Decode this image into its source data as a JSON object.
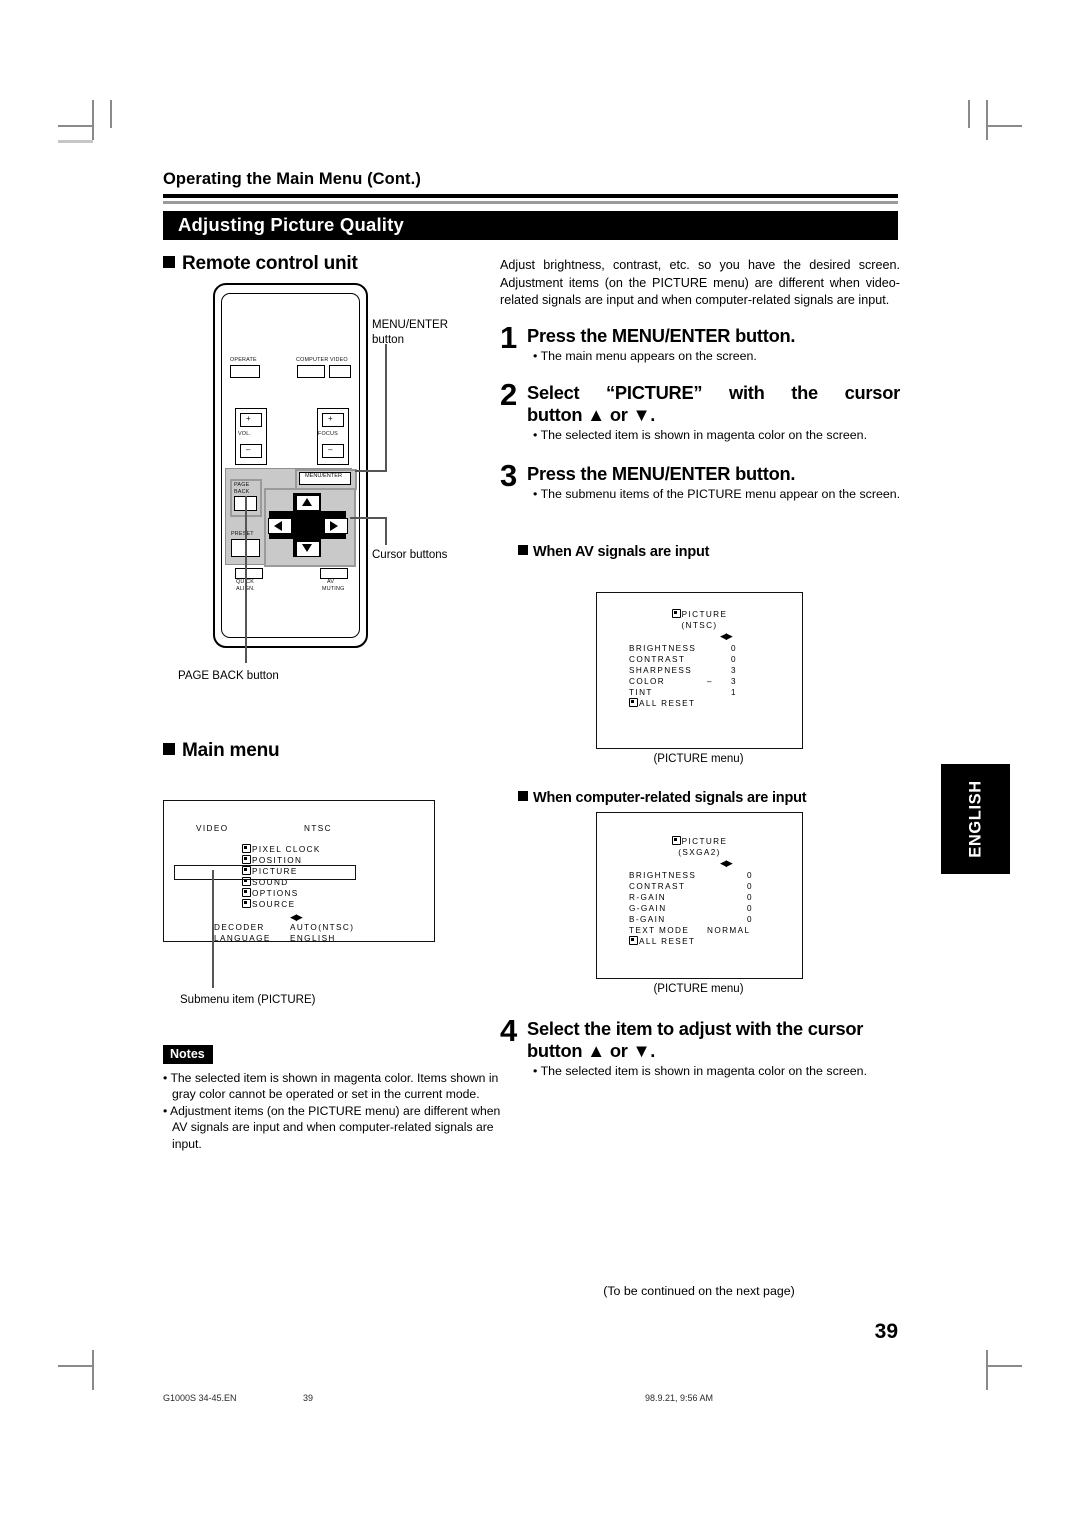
{
  "header": {
    "running_head": "Operating the Main Menu (Cont.)",
    "section_title": "Adjusting Picture Quality"
  },
  "left_column": {
    "remote_heading": "Remote control unit",
    "main_menu_heading": "Main menu",
    "remote": {
      "buttons": [
        {
          "name": "operate",
          "label": "OPERATE"
        },
        {
          "name": "computer",
          "label": "COMPUTER"
        },
        {
          "name": "video",
          "label": "VIDEO"
        },
        {
          "name": "volume",
          "label": "VOL."
        },
        {
          "name": "focus",
          "label": "FOCUS"
        },
        {
          "name": "plus",
          "label": "+"
        },
        {
          "name": "minus",
          "label": "–"
        },
        {
          "name": "menu-enter",
          "label": "MENU/ENTER"
        },
        {
          "name": "page-back",
          "label": "PAGE\nBACK"
        },
        {
          "name": "page-back-line1",
          "label": "PAGE"
        },
        {
          "name": "page-back-line2",
          "label": "BACK"
        },
        {
          "name": "preset",
          "label": "PRESET"
        },
        {
          "name": "quick-align-line1",
          "label": "QUICK"
        },
        {
          "name": "quick-align-line2",
          "label": "ALIGN."
        },
        {
          "name": "av-muting-line1",
          "label": "AV"
        },
        {
          "name": "av-muting-line2",
          "label": "MUTING"
        }
      ],
      "callouts": {
        "menu_enter": "MENU/ENTER\nbutton",
        "menu_enter_line1": "MENU/ENTER",
        "menu_enter_line2": "button",
        "cursor": "Cursor buttons",
        "page_back": "PAGE BACK button"
      }
    },
    "main_menu_osd": {
      "source": "VIDEO",
      "signal": "NTSC",
      "submenu_items": [
        "PIXEL CLOCK",
        "POSITION",
        "PICTURE",
        "SOUND",
        "OPTIONS",
        "SOURCE"
      ],
      "highlighted_item": "PICTURE",
      "arrows": "◀▶",
      "settings": [
        {
          "label": "DECODER",
          "value": "AUTO(NTSC)"
        },
        {
          "label": "LANGUAGE",
          "value": "ENGLISH"
        }
      ],
      "caption": "Submenu item (PICTURE)"
    },
    "notes": {
      "tag": "Notes",
      "items": [
        "The selected item is shown in magenta color. Items shown in gray color cannot be operated or set in the current mode.",
        "Adjustment items (on the PICTURE menu) are different when AV signals are input and when computer-related signals are input."
      ]
    }
  },
  "right_column": {
    "intro": "Adjust brightness, contrast, etc. so you have the desired screen. Adjustment items (on the PICTURE menu) are different when video-related signals are input and when computer-related signals are input.",
    "steps": [
      {
        "number": "1",
        "heading": "Press the MENU/ENTER button.",
        "bullet": "The main menu appears on the screen."
      },
      {
        "number": "2",
        "heading_line1": "Select “PICTURE” with the cursor",
        "heading_line2": "button ▲ or ▼.",
        "bullet": "The selected item is shown in magenta color on the screen."
      },
      {
        "number": "3",
        "heading": "Press the MENU/ENTER button.",
        "bullet": "The submenu items of the PICTURE menu appear on the screen."
      },
      {
        "number": "4",
        "heading_line1": "Select the item to adjust with the cursor",
        "heading_line2": "button ▲ or ▼.",
        "bullet": "The selected item is shown in magenta color on the screen."
      }
    ],
    "av_section": {
      "heading": "When AV signals are input",
      "osd": {
        "title": "PICTURE",
        "signal": "(NTSC)",
        "arrows": "◀▶",
        "rows": [
          {
            "label": "BRIGHTNESS",
            "sign": "",
            "value": "0"
          },
          {
            "label": "CONTRAST",
            "sign": "",
            "value": "0"
          },
          {
            "label": "SHARPNESS",
            "sign": "",
            "value": "3"
          },
          {
            "label": "COLOR",
            "sign": "–",
            "value": "3"
          },
          {
            "label": "TINT",
            "sign": "",
            "value": "1"
          }
        ],
        "reset": "ALL RESET"
      },
      "caption": "(PICTURE menu)"
    },
    "pc_section": {
      "heading": "When computer-related signals are input",
      "osd": {
        "title": "PICTURE",
        "signal": "(SXGA2)",
        "arrows": "◀▶",
        "rows": [
          {
            "label": "BRIGHTNESS",
            "sign": "",
            "value": "0"
          },
          {
            "label": "CONTRAST",
            "sign": "",
            "value": "0"
          },
          {
            "label": "R-GAIN",
            "sign": "",
            "value": "0"
          },
          {
            "label": "G-GAIN",
            "sign": "",
            "value": "0"
          },
          {
            "label": "B-GAIN",
            "sign": "",
            "value": "0"
          },
          {
            "label": "TEXT MODE",
            "sign": "",
            "value": "NORMAL"
          }
        ],
        "reset": "ALL RESET"
      },
      "caption": "(PICTURE menu)"
    },
    "continued": "(To be continued on the next page)"
  },
  "side_tab": "ENGLISH",
  "page_number": "39",
  "print_footer": {
    "file": "G1000S 34-45.EN",
    "page": "39",
    "timestamp": "98.9.21, 9:56 AM"
  }
}
